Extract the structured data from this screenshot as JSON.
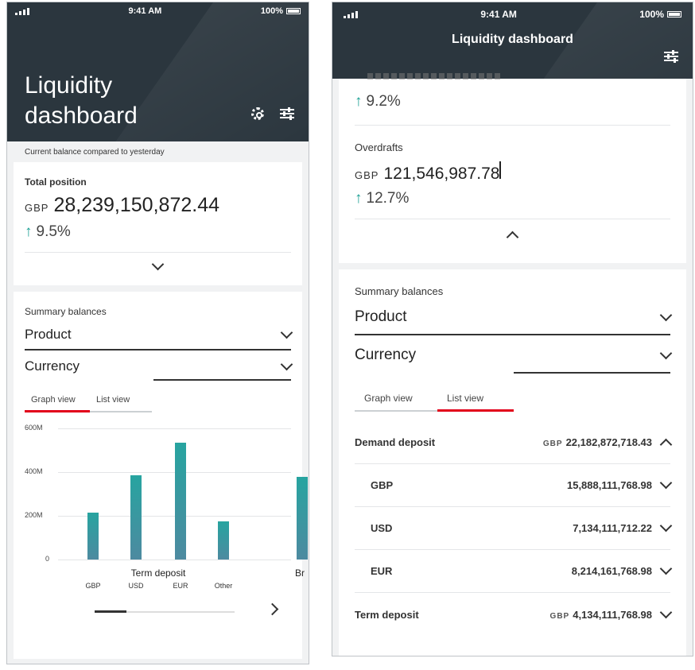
{
  "status": {
    "time": "9:41 AM",
    "battery": "100%"
  },
  "left": {
    "title_line1": "Liquidity",
    "title_line2": "dashboard",
    "caption": "Current balance compared to yesterday",
    "total": {
      "label": "Total position",
      "currency": "GBP",
      "amount": "28,239,150,872.44",
      "change": "9.5%"
    },
    "summary": {
      "label": "Summary balances",
      "product_label": "Product",
      "currency_label": "Currency",
      "tab_graph": "Graph view",
      "tab_list": "List view"
    }
  },
  "chart_data": {
    "type": "bar",
    "y_ticks": [
      "600M",
      "400M",
      "200M",
      "0"
    ],
    "ylim": [
      0,
      600
    ],
    "groups": [
      {
        "name": "Term deposit",
        "categories": [
          "GBP",
          "USD",
          "EUR",
          "Other"
        ],
        "values": [
          215,
          385,
          535,
          175
        ]
      },
      {
        "name": "Br",
        "categories": [],
        "values": [
          380
        ]
      }
    ],
    "bar_color": "#2aa39f"
  },
  "right": {
    "title": "Liquidity dashboard",
    "partial_change": "9.2%",
    "overdrafts": {
      "label": "Overdrafts",
      "currency": "GBP",
      "amount": "121,546,987.78",
      "change": "12.7%"
    },
    "summary": {
      "label": "Summary balances",
      "product_label": "Product",
      "currency_label": "Currency",
      "tab_graph": "Graph view",
      "tab_list": "List view"
    },
    "rows": [
      {
        "name": "Demand deposit",
        "currency": "GBP",
        "amount": "22,182,872,718.43"
      },
      {
        "name": "GBP",
        "amount": "15,888,111,768.98"
      },
      {
        "name": "USD",
        "amount": "7,134,111,712.22"
      },
      {
        "name": "EUR",
        "amount": "8,214,161,768.98"
      },
      {
        "name": "Term deposit",
        "currency": "GBP",
        "amount": "4,134,111,768.98"
      }
    ]
  },
  "colors": {
    "header": "#2b363e",
    "accent_red": "#e2001a",
    "teal": "#1a9f94"
  }
}
